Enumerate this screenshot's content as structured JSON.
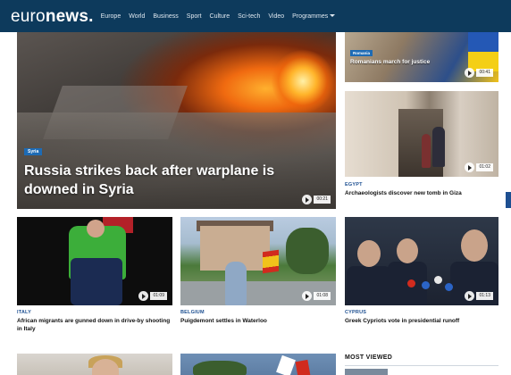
{
  "header": {
    "logo_light": "euro",
    "logo_bold": "news",
    "logo_dot": ".",
    "nav": [
      "Europe",
      "World",
      "Business",
      "Sport",
      "Culture",
      "Sci-tech",
      "Video"
    ],
    "programmes_label": "Programmes"
  },
  "hero": {
    "tag": "Syria",
    "title": "Russia strikes back after warplane is downed in Syria",
    "duration": "00:21"
  },
  "right_top": {
    "tag": "Romania",
    "title": "Romanians march for justice",
    "duration": "00:41"
  },
  "right_middle": {
    "tag": "Egypt",
    "title": "Archaeologists discover new tomb in Giza",
    "duration": "01:02"
  },
  "row2": [
    {
      "tag": "Italy",
      "title": "African migrants are gunned down in drive-by shooting in Italy",
      "duration": "01:09"
    },
    {
      "tag": "Belgium",
      "title": "Puigdemont settles in Waterloo",
      "duration": "01:08"
    },
    {
      "tag": "Cyprus",
      "title": "Greek Cypriots vote in presidential runoff",
      "duration": "01:13"
    }
  ],
  "sidebar": {
    "most_viewed": "MOST VIEWED"
  },
  "colors": {
    "nav_bg": "#0d3a5c",
    "tag_color": "#1d4f91",
    "badge_bg": "#1d6bb5"
  }
}
